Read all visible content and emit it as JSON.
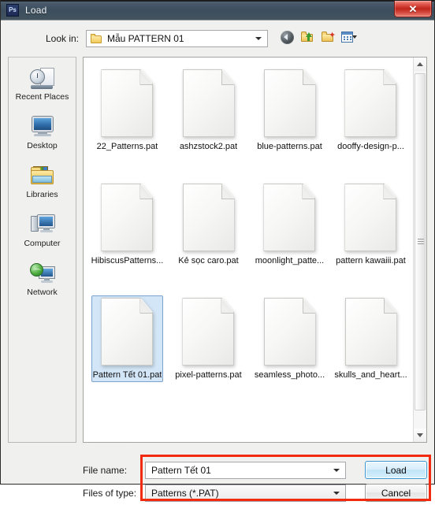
{
  "window": {
    "title": "Load",
    "app_icon": "photoshop-ps-icon",
    "close_label": "✕"
  },
  "toolbar": {
    "lookin_label": "Look in:",
    "lookin_value": "Mẫu PATTERN 01",
    "buttons": [
      {
        "name": "back-button",
        "tip": "Back"
      },
      {
        "name": "up-one-level-button",
        "tip": "Up One Level"
      },
      {
        "name": "new-folder-button",
        "tip": "Create New Folder"
      },
      {
        "name": "views-button",
        "tip": "Views"
      }
    ]
  },
  "places": [
    {
      "label": "Recent Places",
      "icon": "recent-places-icon"
    },
    {
      "label": "Desktop",
      "icon": "desktop-icon"
    },
    {
      "label": "Libraries",
      "icon": "libraries-icon"
    },
    {
      "label": "Computer",
      "icon": "computer-icon"
    },
    {
      "label": "Network",
      "icon": "network-icon"
    }
  ],
  "files": [
    {
      "name": "22_Patterns.pat",
      "selected": false
    },
    {
      "name": "ashzstock2.pat",
      "selected": false
    },
    {
      "name": "blue-patterns.pat",
      "selected": false
    },
    {
      "name": "dooffy-design-p...",
      "selected": false
    },
    {
      "name": "HibiscusPatterns...",
      "selected": false
    },
    {
      "name": "Kẻ sọc caro.pat",
      "selected": false
    },
    {
      "name": "moonlight_patte...",
      "selected": false
    },
    {
      "name": "pattern kawaiii.pat",
      "selected": false
    },
    {
      "name": "Pattern Tết 01.pat",
      "selected": true
    },
    {
      "name": "pixel-patterns.pat",
      "selected": false
    },
    {
      "name": "seamless_photo...",
      "selected": false
    },
    {
      "name": "skulls_and_heart...",
      "selected": false
    }
  ],
  "bottom": {
    "filename_label": "File name:",
    "filename_value": "Pattern Tết 01",
    "filetype_label": "Files of type:",
    "filetype_value": "Patterns (*.PAT)",
    "load_label": "Load",
    "cancel_label": "Cancel"
  },
  "colors": {
    "titlebar": "#3c4e5d",
    "close_button": "#c0261c",
    "selection": "#d3e6f7",
    "selection_border": "#7da2ce",
    "annotation": "#f22a10",
    "load_border": "#3c98d4"
  }
}
